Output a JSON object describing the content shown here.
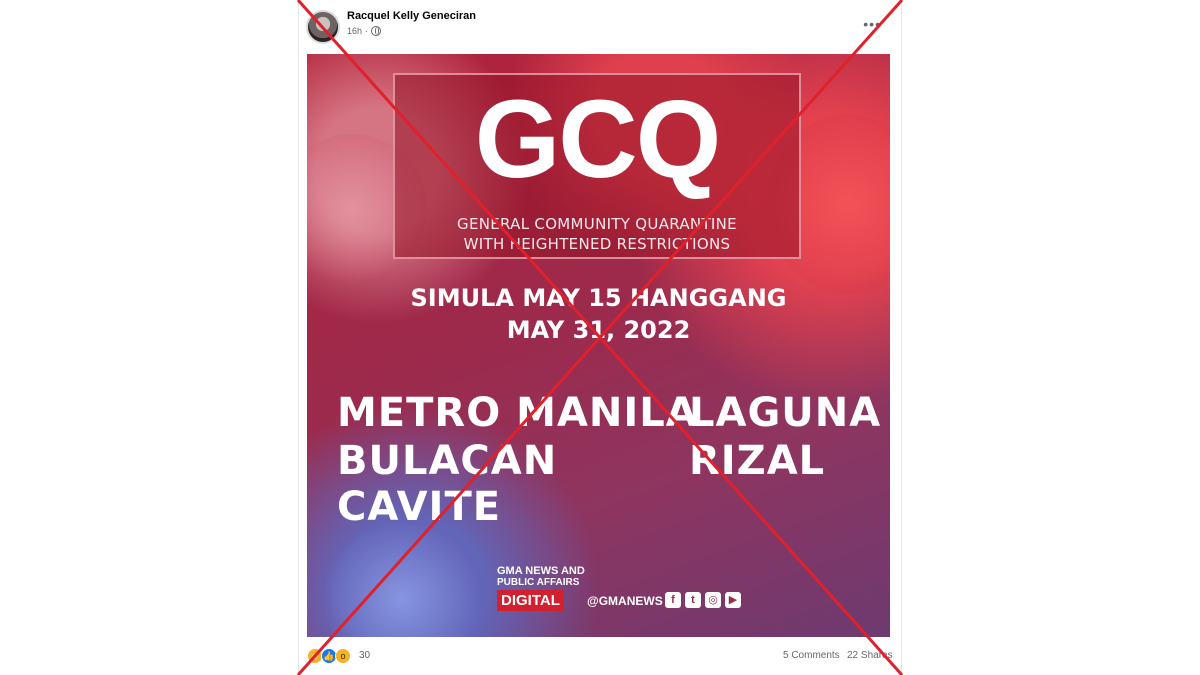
{
  "post": {
    "author": "Racquel Kelly Geneciran",
    "time": "16h",
    "more_label": "•••"
  },
  "image": {
    "title": "GCQ",
    "subtitle_line1": "GENERAL COMMUNITY QUARANTINE",
    "subtitle_line2": "WITH HEIGHTENED RESTRICTIONS",
    "date_line1": "SIMULA MAY 15 HANGGANG",
    "date_line2": "MAY 31, 2022",
    "places": [
      "METRO MANILA",
      "BULACAN",
      "CAVITE",
      "LAGUNA",
      "RIZAL"
    ],
    "brand": {
      "logo": "GMA NEWS AND",
      "logo_sub": "PUBLIC AFFAIRS",
      "digital": "DIGITAL",
      "handle": "@GMANEWS",
      "social_icons": [
        "facebook-icon",
        "twitter-icon",
        "instagram-icon",
        "youtube-icon"
      ]
    }
  },
  "footer": {
    "reaction_count": "30",
    "comments": "5 Comments",
    "shares": "22 Shares"
  },
  "colors": {
    "cross": "#e0202a",
    "digital_badge": "#d3202f"
  }
}
